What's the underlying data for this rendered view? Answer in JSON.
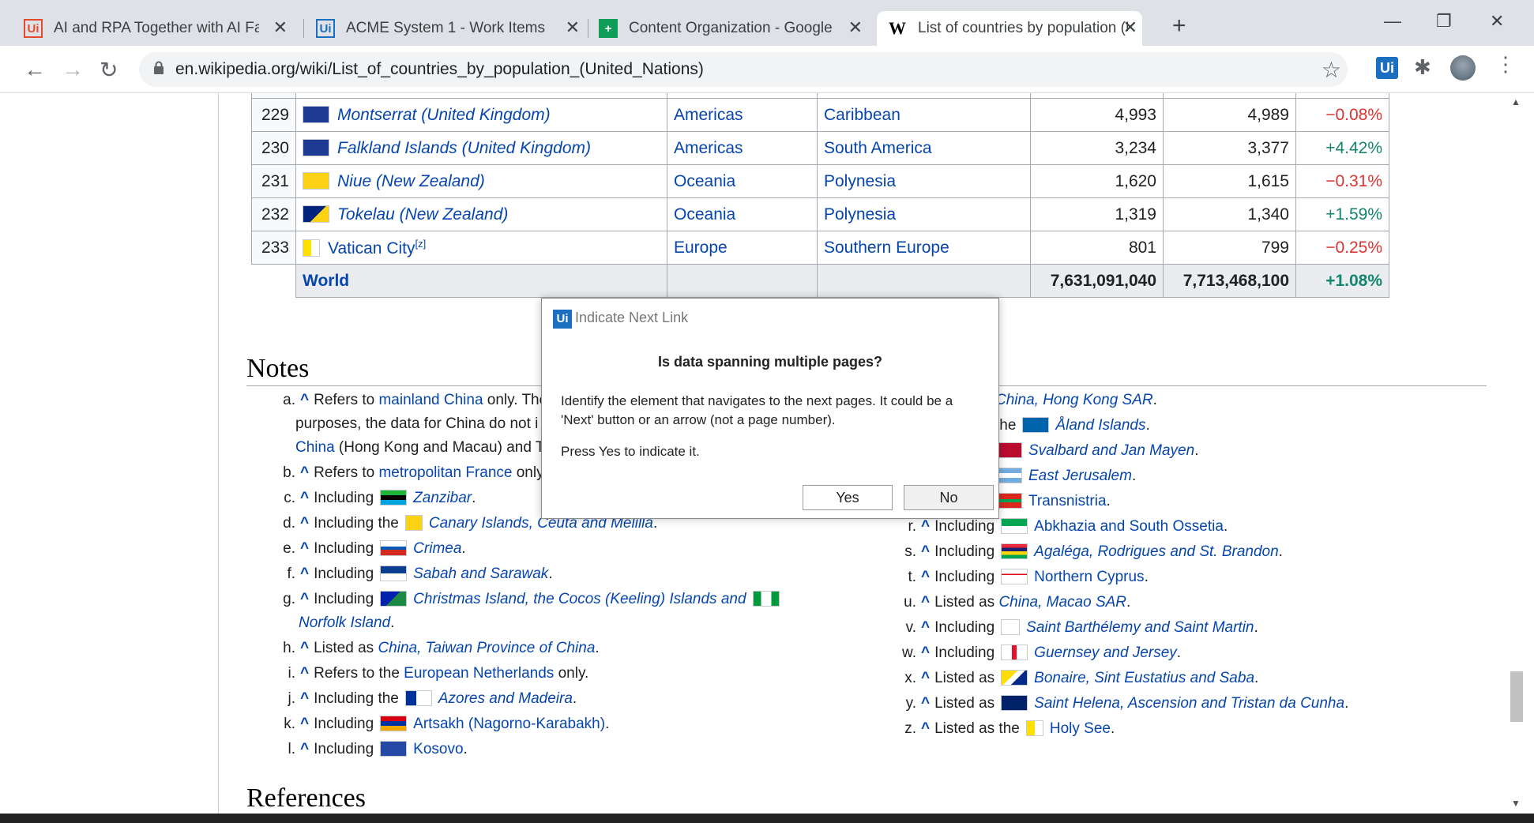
{
  "browser": {
    "tabs": [
      {
        "icon": "Ui",
        "title": "AI and RPA Together with AI Fabr"
      },
      {
        "icon": "Ui",
        "title": "ACME System 1 - Work Items"
      },
      {
        "icon": "+",
        "title": "Content Organization - Google S"
      },
      {
        "icon": "W",
        "title": "List of countries by population (U"
      }
    ],
    "new_tab": "+",
    "url": "en.wikipedia.org/wiki/List_of_countries_by_population_(United_Nations)",
    "ext_label": "Ui"
  },
  "table": {
    "rows": [
      {
        "rank": "229",
        "country": "Montserrat",
        "owner": "(United Kingdom)",
        "region": "Americas",
        "subregion": "Caribbean",
        "pop2018": "4,993",
        "pop2019": "4,989",
        "change": "−0.08%",
        "dir": "neg"
      },
      {
        "rank": "230",
        "country": "Falkland Islands",
        "owner": "(United Kingdom)",
        "region": "Americas",
        "subregion": "South America",
        "pop2018": "3,234",
        "pop2019": "3,377",
        "change": "+4.42%",
        "dir": "pos"
      },
      {
        "rank": "231",
        "country": "Niue",
        "owner": "(New Zealand)",
        "region": "Oceania",
        "subregion": "Polynesia",
        "pop2018": "1,620",
        "pop2019": "1,615",
        "change": "−0.31%",
        "dir": "neg"
      },
      {
        "rank": "232",
        "country": "Tokelau",
        "owner": "(New Zealand)",
        "region": "Oceania",
        "subregion": "Polynesia",
        "pop2018": "1,319",
        "pop2019": "1,340",
        "change": "+1.59%",
        "dir": "pos"
      },
      {
        "rank": "233",
        "country": "Vatican City",
        "owner": "",
        "note": "[z]",
        "region": "Europe",
        "subregion": "Southern Europe",
        "pop2018": "801",
        "pop2019": "799",
        "change": "−0.25%",
        "dir": "neg"
      }
    ],
    "world": {
      "label": "World",
      "pop2018": "7,631,091,040",
      "pop2019": "7,713,468,100",
      "change": "+1.08%"
    }
  },
  "notes": {
    "heading": "Notes",
    "left": [
      {
        "l": "a.",
        "pre": "Refers to ",
        "link": "mainland China",
        "post": " only. The"
      },
      {
        "l": "",
        "pre": "purposes, the data for China do not i",
        "link": "",
        "post": ""
      },
      {
        "l": "",
        "pre": "",
        "link": "China",
        "post": " (Hong Kong and Macau) and T"
      },
      {
        "l": "b.",
        "pre": "Refers to ",
        "link": "metropolitan France",
        "post": " only."
      },
      {
        "l": "c.",
        "pre": "Including",
        "link": "Zanzibar",
        "post": "."
      },
      {
        "l": "d.",
        "pre": "Including the",
        "link": "Canary Islands, Ceuta and Melilla",
        "post": "."
      },
      {
        "l": "e.",
        "pre": "Including",
        "link": "Crimea",
        "post": "."
      },
      {
        "l": "f.",
        "pre": "Including",
        "link": "Sabah and Sarawak",
        "post": "."
      },
      {
        "l": "g.",
        "pre": "Including",
        "link": "Christmas Island, the Cocos (Keeling) Islands and",
        "post": ""
      },
      {
        "l": "",
        "pre": "",
        "link": "Norfolk Island",
        "post": "."
      },
      {
        "l": "h.",
        "pre": "Listed as ",
        "link": "China, Taiwan Province of China",
        "post": "."
      },
      {
        "l": "i.",
        "pre": "Refers to the ",
        "link": "European Netherlands",
        "post": " only."
      },
      {
        "l": "j.",
        "pre": "Including the",
        "link": "Azores and Madeira",
        "post": "."
      },
      {
        "l": "k.",
        "pre": "Including",
        "link": "Artsakh (Nagorno-Karabakh)",
        "post": "."
      },
      {
        "l": "l.",
        "pre": "Including",
        "link": "Kosovo",
        "post": "."
      }
    ],
    "right": [
      {
        "l": "",
        "pre": "",
        "link": "China, Hong Kong SAR",
        "post": "."
      },
      {
        "l": "",
        "pre": "the",
        "link": "Åland Islands",
        "post": "."
      },
      {
        "l": "",
        "pre": "",
        "link": "Svalbard and Jan Mayen",
        "post": "."
      },
      {
        "l": "",
        "pre": "",
        "link": "East Jerusalem",
        "post": "."
      },
      {
        "l": "",
        "pre": "",
        "link": "Transnistria",
        "post": "."
      },
      {
        "l": "r.",
        "pre": "Including",
        "link": "Abkhazia and South Ossetia",
        "post": "."
      },
      {
        "l": "s.",
        "pre": "Including",
        "link": "Agaléga, Rodrigues and St. Brandon",
        "post": "."
      },
      {
        "l": "t.",
        "pre": "Including",
        "link": "Northern Cyprus",
        "post": "."
      },
      {
        "l": "u.",
        "pre": "Listed as ",
        "link": "China, Macao SAR",
        "post": "."
      },
      {
        "l": "v.",
        "pre": "Including",
        "link": "Saint Barthélemy and Saint Martin",
        "post": "."
      },
      {
        "l": "w.",
        "pre": "Including",
        "link": "Guernsey and Jersey",
        "post": "."
      },
      {
        "l": "x.",
        "pre": "Listed as",
        "link": "Bonaire, Sint Eustatius and Saba",
        "post": "."
      },
      {
        "l": "y.",
        "pre": "Listed as",
        "link": "Saint Helena, Ascension and Tristan da Cunha",
        "post": "."
      },
      {
        "l": "z.",
        "pre": "Listed as the",
        "link": "Holy See",
        "post": "."
      }
    ]
  },
  "references_heading": "References",
  "dialog": {
    "logo": "Ui",
    "title": "Indicate Next Link",
    "question": "Is data spanning multiple pages?",
    "body": "Identify the element that navigates to the next pages. It could be a 'Next' button or an arrow (not a page number).",
    "body2": "Press Yes to indicate it.",
    "yes": "Yes",
    "no": "No"
  }
}
